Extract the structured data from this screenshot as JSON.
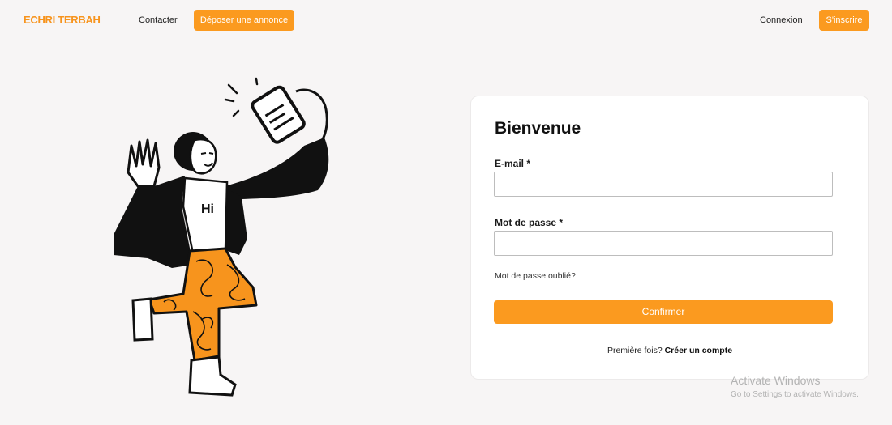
{
  "navbar": {
    "brand": "ECHRI TERBAH",
    "contact_label": "Contacter",
    "post_ad_label": "Déposer une annonce",
    "login_label": "Connexion",
    "signup_label": "S'inscrire"
  },
  "illustration": {
    "shirt_text": "Hi"
  },
  "login_form": {
    "title": "Bienvenue",
    "email_label": "E-mail *",
    "email_value": "",
    "password_label": "Mot de passe *",
    "password_value": "",
    "forgot_label": "Mot de passe oublié?",
    "confirm_label": "Confirmer",
    "first_time_text": "Première fois?",
    "create_account_label": "Créer un compte"
  },
  "watermark": {
    "title": "Activate Windows",
    "subtitle": "Go to Settings to activate Windows."
  },
  "colors": {
    "accent": "#fb9a1f",
    "brand": "#f7941d",
    "background": "#f7f5f5"
  }
}
